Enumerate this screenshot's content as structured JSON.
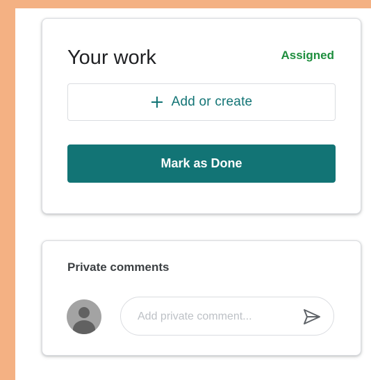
{
  "colors": {
    "frame": "#f4b183",
    "accent": "#127475",
    "status": "#1e8e3e"
  },
  "work": {
    "title": "Your work",
    "status": "Assigned",
    "add_label": "Add or create",
    "done_label": "Mark as Done"
  },
  "comments": {
    "title": "Private comments",
    "placeholder": "Add private comment...",
    "send_icon": "send-icon",
    "avatar_icon": "person-icon"
  }
}
